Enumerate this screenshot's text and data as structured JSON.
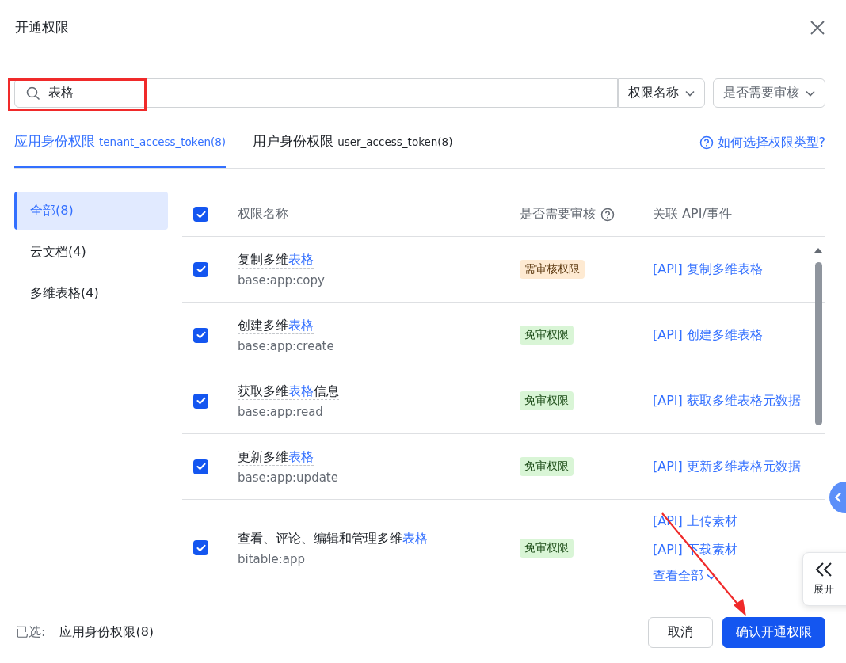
{
  "dialog": {
    "title": "开通权限"
  },
  "search": {
    "value": "表格"
  },
  "filters": [
    {
      "label": "权限名称",
      "active": true
    },
    {
      "label": "是否需要审核",
      "active": false
    }
  ],
  "tabs": [
    {
      "label": "应用身份权限",
      "token": "tenant_access_token(8)",
      "selected": true
    },
    {
      "label": "用户身份权限",
      "token": "user_access_token(8)",
      "selected": false
    }
  ],
  "help_link": "如何选择权限类型?",
  "sidebar": {
    "items": [
      {
        "label": "全部(8)",
        "selected": true
      },
      {
        "label": "云文档(4)",
        "selected": false
      },
      {
        "label": "多维表格(4)",
        "selected": false
      }
    ]
  },
  "table": {
    "all_checked": true,
    "columns": [
      "权限名称",
      "是否需要审核",
      "关联 API/事件"
    ],
    "rows": [
      {
        "checked": true,
        "name": {
          "prefix": "复制多维",
          "match": "表格"
        },
        "scope": "base:app:copy",
        "review": {
          "label": "需审核权限",
          "kind": "review"
        },
        "apis": [
          "[API] 复制多维表格"
        ]
      },
      {
        "checked": true,
        "name": {
          "prefix": "创建多维",
          "match": "表格"
        },
        "scope": "base:app:create",
        "review": {
          "label": "免审权限",
          "kind": "free"
        },
        "apis": [
          "[API] 创建多维表格"
        ]
      },
      {
        "checked": true,
        "name": {
          "prefix": "获取多维",
          "match": "表格",
          "suffix": "信息"
        },
        "scope": "base:app:read",
        "review": {
          "label": "免审权限",
          "kind": "free"
        },
        "apis": [
          "[API] 获取多维表格元数据"
        ]
      },
      {
        "checked": true,
        "name": {
          "prefix": "更新多维",
          "match": "表格"
        },
        "scope": "base:app:update",
        "review": {
          "label": "免审权限",
          "kind": "free"
        },
        "apis": [
          "[API] 更新多维表格元数据"
        ]
      },
      {
        "checked": true,
        "name": {
          "prefix": "查看、评论、编辑和管理多维",
          "match": "表格"
        },
        "scope": "bitable:app",
        "review": {
          "label": "免审权限",
          "kind": "free"
        },
        "apis": [
          "[API] 上传素材",
          "[API] 下载素材"
        ],
        "more": "查看全部"
      }
    ]
  },
  "footer": {
    "label": "已选:",
    "selected": "应用身份权限(8)",
    "buttons": [
      {
        "label": "取消",
        "kind": "secondary"
      },
      {
        "label": "确认开通权限",
        "kind": "primary"
      }
    ]
  },
  "side_panel": {
    "label": "展开"
  }
}
